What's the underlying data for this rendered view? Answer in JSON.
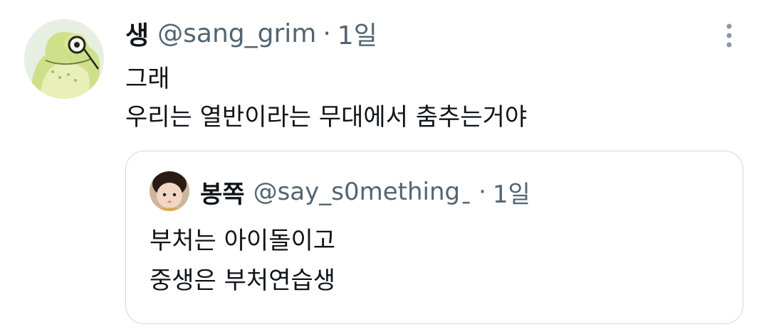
{
  "tweet": {
    "avatar_icon": "frog-with-monocle-avatar",
    "display_name": "생",
    "handle": "@sang_grim",
    "separator": "·",
    "time": "1일",
    "more_icon": "more-vertical-icon",
    "lines": [
      "그래",
      "우리는 열반이라는 무대에서 춤추는거야"
    ]
  },
  "quoted_tweet": {
    "avatar_icon": "child-photo-avatar",
    "display_name": "봉쪽",
    "handle": "@say_s0methingˍ",
    "separator": "·",
    "time": "1일",
    "lines": [
      "부처는 아이돌이고",
      "중생은 부처연습생"
    ]
  },
  "colors": {
    "text_primary": "#0f1419",
    "text_secondary": "#536471",
    "border": "#cfd9de",
    "background": "#ffffff"
  }
}
